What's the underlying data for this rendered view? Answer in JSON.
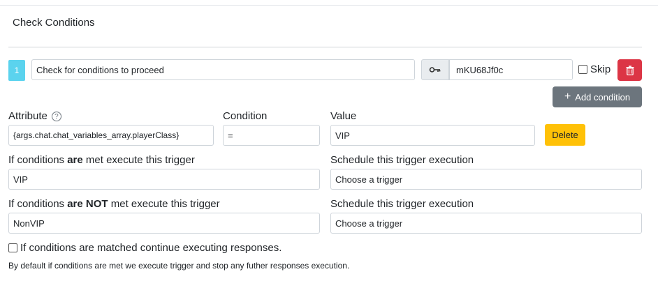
{
  "section": {
    "title": "Check Conditions"
  },
  "condition_group": {
    "index": "1",
    "name_value": "Check for conditions to proceed",
    "key_value": "mKU68Jf0c",
    "skip_label": "Skip",
    "add_condition_label": "Add condition"
  },
  "condition": {
    "attribute_label": "Attribute",
    "attribute_value": "{args.chat.chat_variables_array.playerClass}",
    "condition_label": "Condition",
    "condition_value": "=",
    "value_label": "Value",
    "value_value": "VIP",
    "delete_label": "Delete"
  },
  "met": {
    "label_prefix": "If conditions ",
    "label_bold": "are",
    "label_suffix": " met execute this trigger",
    "value": "VIP",
    "schedule_label": "Schedule this trigger execution",
    "schedule_value": "Choose a trigger"
  },
  "not_met": {
    "label_prefix": "If conditions ",
    "label_bold": "are NOT",
    "label_suffix": " met execute this trigger",
    "value": "NonVIP",
    "schedule_label": "Schedule this trigger execution",
    "schedule_value": "Choose a trigger"
  },
  "continue_label": "If conditions are matched continue executing responses.",
  "note": "By default if conditions are met we execute trigger and stop any futher responses execution.",
  "colors": {
    "info": "#5bd3ee",
    "danger": "#dc3545",
    "secondary": "#6c757d",
    "warning": "#ffc107"
  },
  "icons": {
    "key": "key-icon",
    "trash": "trash-icon",
    "plus": "plus-icon",
    "help": "help-circle-icon"
  }
}
